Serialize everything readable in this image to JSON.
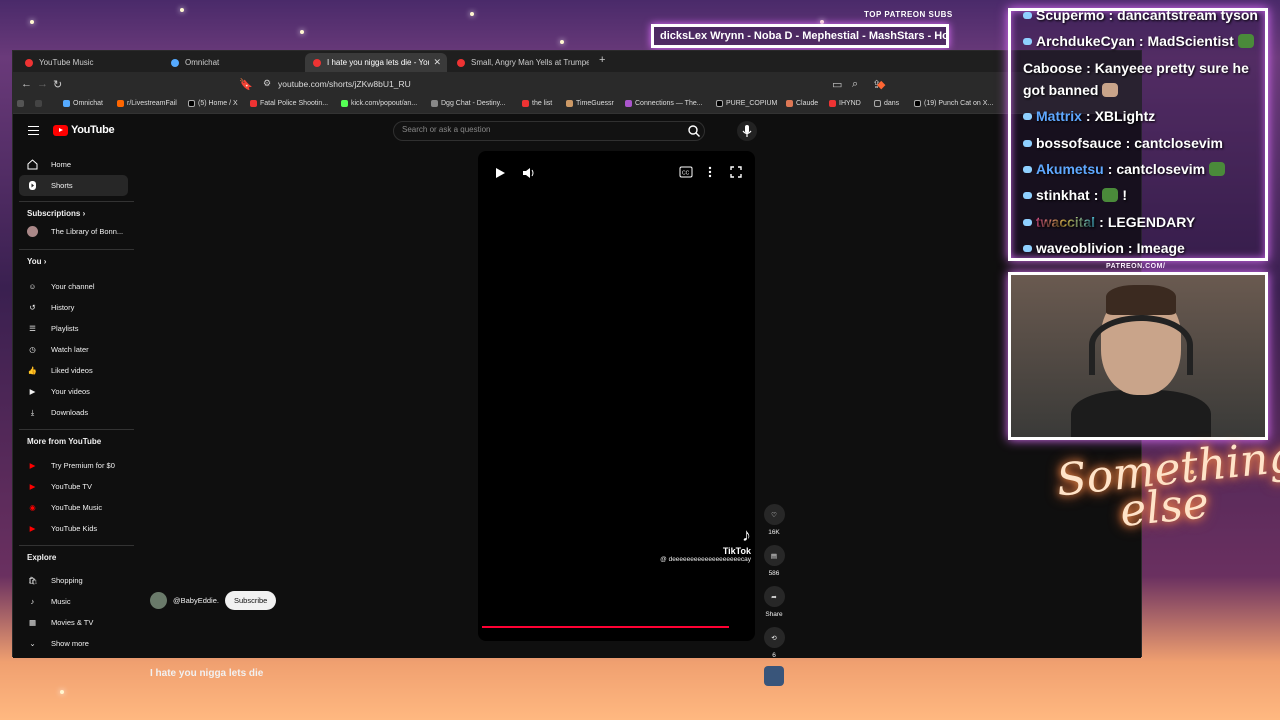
{
  "tabs": [
    {
      "label": "YouTube Music"
    },
    {
      "label": "Omnichat"
    },
    {
      "label": "I hate you nigga lets die - YouTub"
    },
    {
      "label": "Small, Angry Man Yells at Trumpet Pl"
    }
  ],
  "address": {
    "url": "youtube.com/shorts/jZKw8bU1_RU"
  },
  "bookmarks": [
    "Omnichat",
    "r/LivestreamFail",
    "(5) Home / X",
    "Fatal Police Shootin...",
    "kick.com/popout/an...",
    "Dgg Chat - Destiny...",
    "the list",
    "TimeGuessr",
    "Connections — The...",
    "PURE_COPIUM",
    "Claude",
    "IHYND",
    "dans",
    "(19) Punch Cat on X..."
  ],
  "youtube": {
    "logo": "YouTube",
    "search_placeholder": "Search or ask a question"
  },
  "sidebar": {
    "top": [
      {
        "label": "Home"
      },
      {
        "label": "Shorts"
      }
    ],
    "subscriptions_heading": "Subscriptions",
    "subscriptions": [
      {
        "label": "The Library of Bonn..."
      }
    ],
    "you_heading": "You",
    "you": [
      {
        "label": "Your channel"
      },
      {
        "label": "History"
      },
      {
        "label": "Playlists"
      },
      {
        "label": "Watch later"
      },
      {
        "label": "Liked videos"
      },
      {
        "label": "Your videos"
      },
      {
        "label": "Downloads"
      }
    ],
    "more_heading": "More from YouTube",
    "more": [
      {
        "label": "Try Premium for $0"
      },
      {
        "label": "YouTube TV"
      },
      {
        "label": "YouTube Music"
      },
      {
        "label": "YouTube Kids"
      }
    ],
    "explore_heading": "Explore",
    "explore": [
      {
        "label": "Shopping"
      },
      {
        "label": "Music"
      },
      {
        "label": "Movies & TV"
      }
    ],
    "show_more": "Show more"
  },
  "player": {
    "tiktok_label": "TikTok",
    "tiktok_user": "@ deeeeeeeeeeeeeeeeeeecay",
    "progress": 0.92
  },
  "actions": {
    "likes": "16K",
    "comments": "586",
    "share": "Share",
    "remix": "6"
  },
  "video": {
    "channel": "@BabyEddie.",
    "subscribe": "Subscribe",
    "title": "I hate you nigga lets die"
  },
  "overlay": {
    "top_patreon_label": "TOP PATREON SUBS",
    "ticker": "dicksLex Wrynn  -  Noba D  -  Mephestial  -  MashStars  -  Ho",
    "chat": [
      {
        "user": "Scupermo",
        "text": "dancantstream tyson"
      },
      {
        "user": "ArchdukeCyan",
        "text": "MadScientist"
      },
      {
        "user": "Caboose",
        "text": "Kanyeee pretty sure he"
      },
      {
        "user": "",
        "text": "got banned"
      },
      {
        "user": "Mattrix",
        "text": "XBLightz"
      },
      {
        "user": "bossofsauce",
        "text": "cantclosevim"
      },
      {
        "user": "Akumetsu",
        "text": "cantclosevim"
      },
      {
        "user": "stinkhat",
        "text": "!"
      },
      {
        "user": "twaccital",
        "text": "LEGENDARY"
      },
      {
        "user": "waveoblivion",
        "text": "Imeage"
      }
    ],
    "patreon_url": "PATREON.COM/",
    "brand_line1": "Something",
    "brand_line2": "else"
  }
}
